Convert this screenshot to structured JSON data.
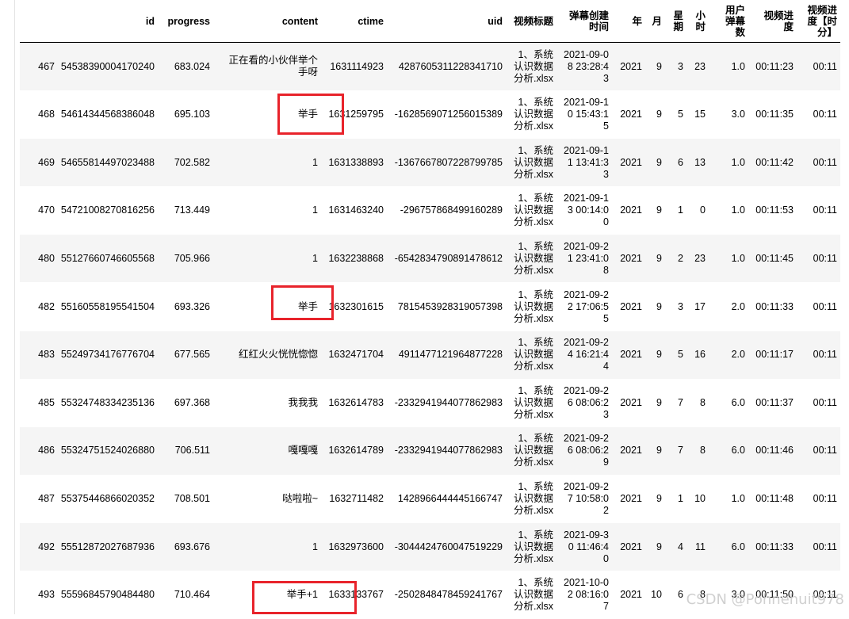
{
  "columns": {
    "idx": "",
    "id": "id",
    "progress": "progress",
    "content": "content",
    "ctime": "ctime",
    "uid": "uid",
    "video_title": "视频标题",
    "created_time": "弹幕创建时间",
    "year": "年",
    "month": "月",
    "weekday": "星期",
    "hour": "小时",
    "user_count": "用户弹幕数",
    "video_progress": "视频进度",
    "video_progress_hm": "视频进度【时分】"
  },
  "rows": [
    {
      "idx": "467",
      "id": "54538390004170240",
      "progress": "683.024",
      "content": "正在看的小伙伴举个手呀",
      "ctime": "1631114923",
      "uid": "4287605311228341710",
      "video_title": "1、系统认识数据分析.xlsx",
      "created_time": "2021-09-08 23:28:43",
      "year": "2021",
      "month": "9",
      "weekday": "3",
      "hour": "23",
      "user_count": "1.0",
      "video_progress": "00:11:23",
      "video_progress_hm": "00:11"
    },
    {
      "idx": "468",
      "id": "54614344568386048",
      "progress": "695.103",
      "content": "举手",
      "ctime": "1631259795",
      "uid": "-1628569071256015389",
      "video_title": "1、系统认识数据分析.xlsx",
      "created_time": "2021-09-10 15:43:15",
      "year": "2021",
      "month": "9",
      "weekday": "5",
      "hour": "15",
      "user_count": "3.0",
      "video_progress": "00:11:35",
      "video_progress_hm": "00:11"
    },
    {
      "idx": "469",
      "id": "54655814497023488",
      "progress": "702.582",
      "content": "1",
      "ctime": "1631338893",
      "uid": "-1367667807228799785",
      "video_title": "1、系统认识数据分析.xlsx",
      "created_time": "2021-09-11 13:41:33",
      "year": "2021",
      "month": "9",
      "weekday": "6",
      "hour": "13",
      "user_count": "1.0",
      "video_progress": "00:11:42",
      "video_progress_hm": "00:11"
    },
    {
      "idx": "470",
      "id": "54721008270816256",
      "progress": "713.449",
      "content": "1",
      "ctime": "1631463240",
      "uid": "-296757868499160289",
      "video_title": "1、系统认识数据分析.xlsx",
      "created_time": "2021-09-13 00:14:00",
      "year": "2021",
      "month": "9",
      "weekday": "1",
      "hour": "0",
      "user_count": "1.0",
      "video_progress": "00:11:53",
      "video_progress_hm": "00:11"
    },
    {
      "idx": "480",
      "id": "55127660746605568",
      "progress": "705.966",
      "content": "1",
      "ctime": "1632238868",
      "uid": "-6542834790891478612",
      "video_title": "1、系统认识数据分析.xlsx",
      "created_time": "2021-09-21 23:41:08",
      "year": "2021",
      "month": "9",
      "weekday": "2",
      "hour": "23",
      "user_count": "1.0",
      "video_progress": "00:11:45",
      "video_progress_hm": "00:11"
    },
    {
      "idx": "482",
      "id": "55160558195541504",
      "progress": "693.326",
      "content": "举手",
      "ctime": "1632301615",
      "uid": "7815453928319057398",
      "video_title": "1、系统认识数据分析.xlsx",
      "created_time": "2021-09-22 17:06:55",
      "year": "2021",
      "month": "9",
      "weekday": "3",
      "hour": "17",
      "user_count": "2.0",
      "video_progress": "00:11:33",
      "video_progress_hm": "00:11"
    },
    {
      "idx": "483",
      "id": "55249734176776704",
      "progress": "677.565",
      "content": "红红火火恍恍惚惚",
      "ctime": "1632471704",
      "uid": "4911477121964877228",
      "video_title": "1、系统认识数据分析.xlsx",
      "created_time": "2021-09-24 16:21:44",
      "year": "2021",
      "month": "9",
      "weekday": "5",
      "hour": "16",
      "user_count": "2.0",
      "video_progress": "00:11:17",
      "video_progress_hm": "00:11"
    },
    {
      "idx": "485",
      "id": "55324748334235136",
      "progress": "697.368",
      "content": "我我我",
      "ctime": "1632614783",
      "uid": "-2332941944077862983",
      "video_title": "1、系统认识数据分析.xlsx",
      "created_time": "2021-09-26 08:06:23",
      "year": "2021",
      "month": "9",
      "weekday": "7",
      "hour": "8",
      "user_count": "6.0",
      "video_progress": "00:11:37",
      "video_progress_hm": "00:11"
    },
    {
      "idx": "486",
      "id": "55324751524026880",
      "progress": "706.511",
      "content": "嘎嘎嘎",
      "ctime": "1632614789",
      "uid": "-2332941944077862983",
      "video_title": "1、系统认识数据分析.xlsx",
      "created_time": "2021-09-26 08:06:29",
      "year": "2021",
      "month": "9",
      "weekday": "7",
      "hour": "8",
      "user_count": "6.0",
      "video_progress": "00:11:46",
      "video_progress_hm": "00:11"
    },
    {
      "idx": "487",
      "id": "55375446866020352",
      "progress": "708.501",
      "content": "哒啦啦~",
      "ctime": "1632711482",
      "uid": "1428966444445166747",
      "video_title": "1、系统认识数据分析.xlsx",
      "created_time": "2021-09-27 10:58:02",
      "year": "2021",
      "month": "9",
      "weekday": "1",
      "hour": "10",
      "user_count": "1.0",
      "video_progress": "00:11:48",
      "video_progress_hm": "00:11"
    },
    {
      "idx": "492",
      "id": "55512872027687936",
      "progress": "693.676",
      "content": "1",
      "ctime": "1632973600",
      "uid": "-3044424760047519229",
      "video_title": "1、系统认识数据分析.xlsx",
      "created_time": "2021-09-30 11:46:40",
      "year": "2021",
      "month": "9",
      "weekday": "4",
      "hour": "11",
      "user_count": "6.0",
      "video_progress": "00:11:33",
      "video_progress_hm": "00:11"
    },
    {
      "idx": "493",
      "id": "55596845790484480",
      "progress": "710.464",
      "content": "举手+1",
      "ctime": "1633133767",
      "uid": "-2502848478459241767",
      "video_title": "1、系统认识数据分析.xlsx",
      "created_time": "2021-10-02 08:16:07",
      "year": "2021",
      "month": "10",
      "weekday": "6",
      "hour": "8",
      "user_count": "3.0",
      "video_progress": "00:11:50",
      "video_progress_hm": "00:11"
    }
  ],
  "watermark": "CSDN @Pohnehuit978",
  "colors": {
    "highlight": "#e8232b",
    "stripe": "#f5f5f5",
    "header_rule": "#000000"
  }
}
